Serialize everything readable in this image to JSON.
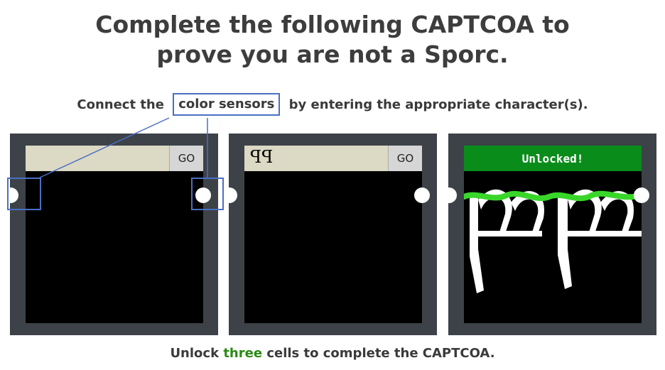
{
  "title_line1": "Complete the following CAPTCOA to",
  "title_line2": "prove you are not a Sporc.",
  "instruction": {
    "prefix": "Connect the",
    "highlight": "color sensors",
    "suffix": "by entering the appropriate character(s)."
  },
  "cells": [
    {
      "input_value": "",
      "go_label": "GO"
    },
    {
      "input_value": "ꟼꟼ",
      "go_label": "GO"
    },
    {
      "status": "Unlocked!"
    }
  ],
  "footer": {
    "prefix": "Unlock",
    "highlight": "three",
    "suffix": "cells to complete the CAPTCOA."
  },
  "colors": {
    "panel": "#3c4248",
    "input_bg": "#dcd9c4",
    "unlocked_bg": "#0a8c1a",
    "callout": "#4a6fc4",
    "sensor_line": "#39d62a"
  }
}
